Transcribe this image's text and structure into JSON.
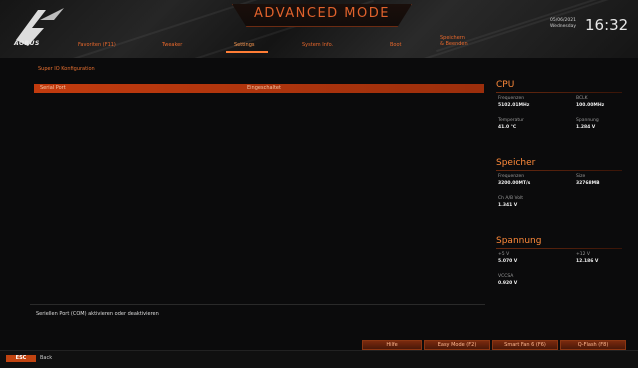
{
  "header": {
    "mode_title": "ADVANCED MODE",
    "logo_text": "AORUS",
    "date": "05/06/2021",
    "weekday": "Wednesday",
    "time": "16:32",
    "tabs": [
      {
        "label": "Favoriten (F11)"
      },
      {
        "label": "Tweaker"
      },
      {
        "label": "Settings"
      },
      {
        "label": "System Info."
      },
      {
        "label": "Boot"
      },
      {
        "label": "Speichern & Beenden"
      }
    ],
    "active_tab": "Settings"
  },
  "main": {
    "section_title": "Super IO Konfiguration",
    "rows": [
      {
        "label": "Serial Port",
        "value": "Eingeschaltet"
      }
    ],
    "help_text": "Seriellen Port (COM) aktivieren oder deaktivieren"
  },
  "sidebar": {
    "cpu": {
      "title": "CPU",
      "freq_label": "Frequenzen",
      "freq_value": "5102.01MHz",
      "bclk_label": "BCLK",
      "bclk_value": "100.00MHz",
      "temp_label": "Temperatur",
      "temp_value": "41.0 °C",
      "volt_label": "Spannung",
      "volt_value": "1.284 V"
    },
    "memory": {
      "title": "Speicher",
      "freq_label": "Frequenzen",
      "freq_value": "3200.00MT/s",
      "size_label": "Size",
      "size_value": "32768MB",
      "ch_label": "Ch A/B Volt",
      "ch_value": "1.341 V"
    },
    "voltage": {
      "title": "Spannung",
      "p5_label": "+5 V",
      "p5_value": "5.070 V",
      "p12_label": "+12 V",
      "p12_value": "12.186 V",
      "vccsa_label": "VCCSA",
      "vccsa_value": "0.920 V"
    }
  },
  "footer": {
    "buttons": [
      {
        "label": "Hilfe"
      },
      {
        "label": "Easy Mode (F2)"
      },
      {
        "label": "Smart Fan 6 (F6)"
      },
      {
        "label": "Q-Flash (F8)"
      }
    ],
    "esc_key": "ESC",
    "esc_label": "Back"
  },
  "colors": {
    "accent": "#e8682c",
    "row_highlight": "#c23b0e"
  }
}
